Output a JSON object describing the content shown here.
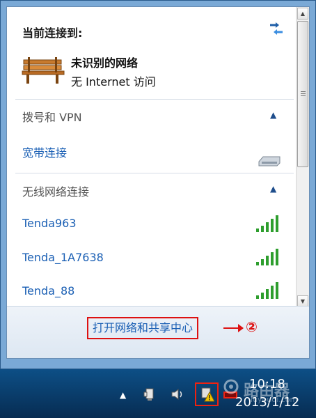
{
  "popup": {
    "current_connection_label": "当前连接到:",
    "network_name": "未识别的网络",
    "network_status": "无 Internet 访问",
    "share_center_link": "打开网络和共享中心",
    "callout": "②"
  },
  "sections": [
    {
      "title": "拨号和 VPN",
      "items": [
        {
          "label": "宽带连接",
          "icon": "modem-icon"
        }
      ]
    },
    {
      "title": "无线网络连接",
      "items": [
        {
          "label": "Tenda963",
          "icon": "signal-strength-icon"
        },
        {
          "label": "Tenda_1A7638",
          "icon": "signal-strength-icon"
        },
        {
          "label": "Tenda_88",
          "icon": "signal-strength-icon"
        }
      ]
    }
  ],
  "taskbar": {
    "time": "10:18",
    "date": "2013/1/12"
  },
  "watermark": {
    "text": "路由器",
    "url": "luyouqi.com"
  },
  "colors": {
    "link": "#1a5fb4",
    "highlight": "#dd1111",
    "taskbar": "#0d4f86",
    "signal": "#2e9e2e"
  }
}
